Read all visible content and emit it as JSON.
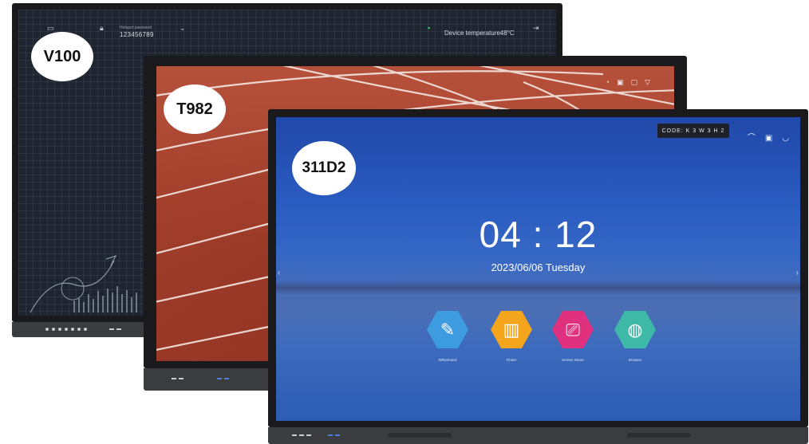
{
  "v100": {
    "model_badge": "V100",
    "hotspot_title": "Hotspot password",
    "hotspot_password": "123456789",
    "device_temperature": "Device temperature48°C"
  },
  "t982": {
    "model_badge": "T982"
  },
  "d311": {
    "model_badge": "311D2",
    "code": "CODE: K 3 W 3 H 2",
    "time": "04 : 12",
    "date": "2023/06/06  Tuesday",
    "apps": [
      {
        "label": "Whiteboard",
        "icon": "pen-icon",
        "color": "#3d9be0"
      },
      {
        "label": "Finder",
        "icon": "folder-icon",
        "color": "#f4a51c"
      },
      {
        "label": "Screen Share",
        "icon": "screen-share-icon",
        "color": "#e0317f"
      },
      {
        "label": "Browser",
        "icon": "globe-icon",
        "color": "#3eb9a8"
      }
    ]
  }
}
